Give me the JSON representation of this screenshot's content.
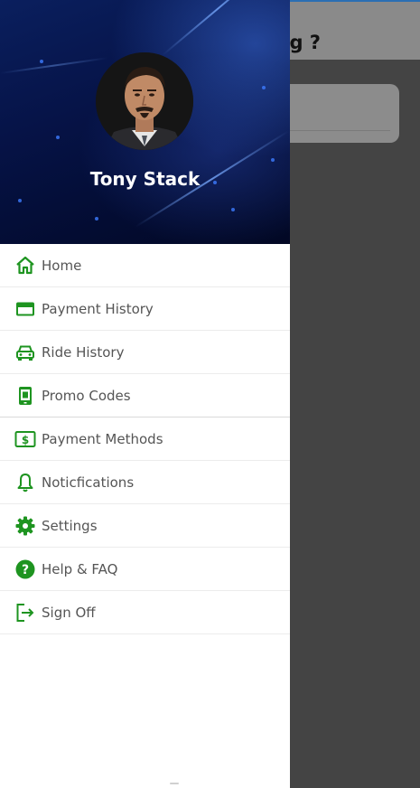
{
  "background_app": {
    "title_fragment": "g ?"
  },
  "drawer": {
    "user_name": "Tony Stack",
    "menu": [
      {
        "label": "Home",
        "icon": "home-icon"
      },
      {
        "label": "Payment History",
        "icon": "credit-card-icon"
      },
      {
        "label": "Ride History",
        "icon": "car-icon"
      },
      {
        "label": "Promo Codes",
        "icon": "promo-code-icon"
      },
      {
        "label": "Payment Methods",
        "icon": "money-icon"
      },
      {
        "label": "Noticfications",
        "icon": "bell-icon"
      },
      {
        "label": "Settings",
        "icon": "gear-icon"
      },
      {
        "label": "Help & FAQ",
        "icon": "help-icon"
      },
      {
        "label": "Sign Off",
        "icon": "sign-out-icon"
      }
    ]
  },
  "colors": {
    "accent_green": "#1e9420",
    "label_gray": "#555555",
    "header_navy": "#061347",
    "scrim": "#444444"
  }
}
